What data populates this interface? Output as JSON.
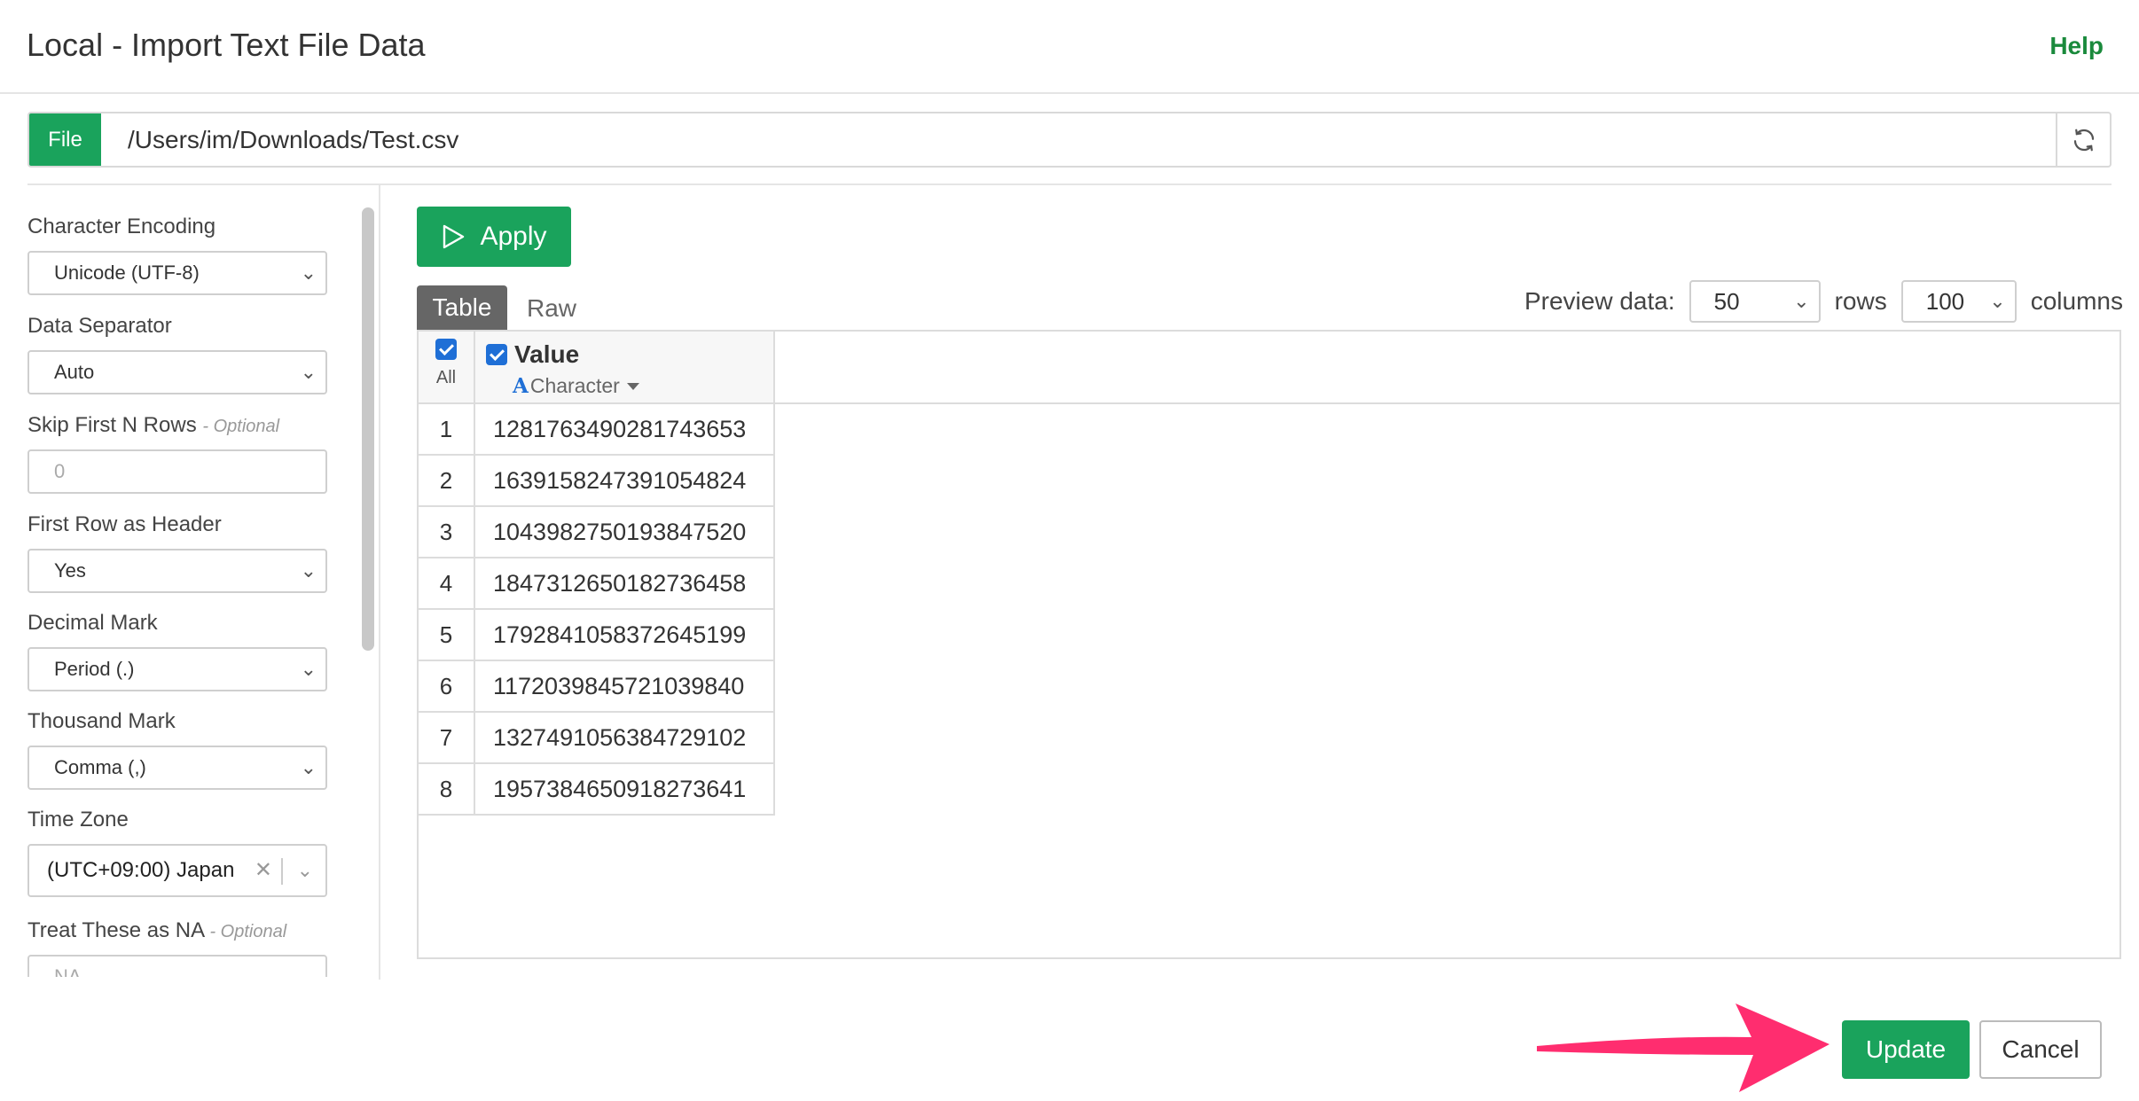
{
  "header": {
    "title": "Local - Import Text File Data",
    "help_label": "Help"
  },
  "file": {
    "label": "File",
    "path": "/Users/im/Downloads/Test.csv"
  },
  "settings": {
    "encoding": {
      "label": "Character Encoding",
      "value": "Unicode (UTF-8)"
    },
    "separator": {
      "label": "Data Separator",
      "value": "Auto"
    },
    "skip_rows": {
      "label": "Skip First N Rows",
      "optional": "- Optional",
      "placeholder": "0"
    },
    "first_row_header": {
      "label": "First Row as Header",
      "value": "Yes"
    },
    "decimal_mark": {
      "label": "Decimal Mark",
      "value": "Period (.)"
    },
    "thousand_mark": {
      "label": "Thousand Mark",
      "value": "Comma (,)"
    },
    "time_zone": {
      "label": "Time Zone",
      "value": "(UTC+09:00) Japan"
    },
    "treat_na": {
      "label": "Treat These as NA",
      "optional": "- Optional",
      "placeholder": "NA"
    }
  },
  "toolbar": {
    "apply_label": "Apply"
  },
  "tabs": {
    "table": "Table",
    "raw": "Raw"
  },
  "preview": {
    "label": "Preview data:",
    "rows_value": "50",
    "rows_label": "rows",
    "cols_value": "100",
    "cols_label": "columns"
  },
  "table": {
    "all_label": "All",
    "column_name": "Value",
    "column_type": "Character",
    "rows": [
      {
        "idx": "1",
        "value": "1281763490281743653"
      },
      {
        "idx": "2",
        "value": "1639158247391054824"
      },
      {
        "idx": "3",
        "value": "1043982750193847520"
      },
      {
        "idx": "4",
        "value": "1847312650182736458"
      },
      {
        "idx": "5",
        "value": "1792841058372645199"
      },
      {
        "idx": "6",
        "value": "1172039845721039840"
      },
      {
        "idx": "7",
        "value": "1327491056384729102"
      },
      {
        "idx": "8",
        "value": "1957384650918273641"
      }
    ]
  },
  "footer": {
    "update_label": "Update",
    "cancel_label": "Cancel"
  },
  "colors": {
    "accent_green": "#1aa35c",
    "help_green": "#1a8a3c",
    "checkbox_blue": "#1f6fd6",
    "arrow_pink": "#ff2d6f"
  }
}
